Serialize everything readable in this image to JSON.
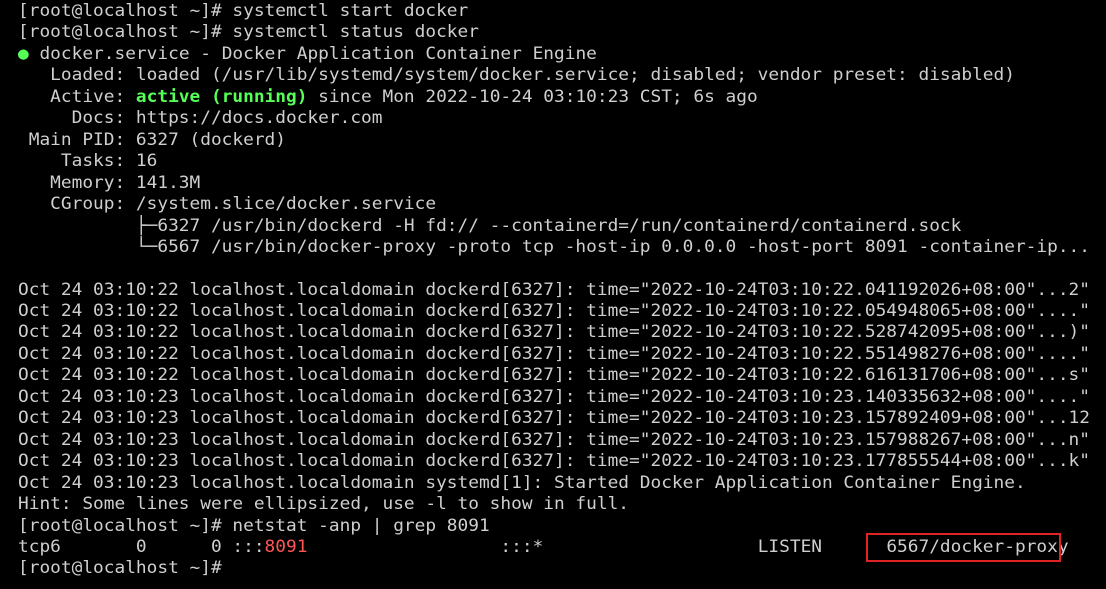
{
  "colors": {
    "background": "#000000",
    "text": "#cfcfcf",
    "active_green": "#55ff55",
    "port_red": "#ff5555",
    "highlight_border": "#e02424"
  },
  "lines": {
    "l01": "[root@localhost ~]# systemctl start docker",
    "l02": "[root@localhost ~]# systemctl status docker",
    "l03_bullet": "●",
    "l03_text": " docker.service - Docker Application Container Engine",
    "l04": "   Loaded: loaded (/usr/lib/systemd/system/docker.service; disabled; vendor preset: disabled)",
    "l05_label": "   Active: ",
    "l05_status": "active (running)",
    "l05_rest": " since Mon 2022-10-24 03:10:23 CST; 6s ago",
    "l06": "     Docs: https://docs.docker.com",
    "l07": " Main PID: 6327 (dockerd)",
    "l08": "    Tasks: 16",
    "l09": "   Memory: 141.3M",
    "l10": "   CGroup: /system.slice/docker.service",
    "l11": "           ├─6327 /usr/bin/dockerd -H fd:// --containerd=/run/containerd/containerd.sock",
    "l12": "           └─6567 /usr/bin/docker-proxy -proto tcp -host-ip 0.0.0.0 -host-port 8091 -container-ip...",
    "l13": "Oct 24 03:10:22 localhost.localdomain dockerd[6327]: time=\"2022-10-24T03:10:22.041192026+08:00\"...2\"",
    "l14": "Oct 24 03:10:22 localhost.localdomain dockerd[6327]: time=\"2022-10-24T03:10:22.054948065+08:00\"....\"",
    "l15": "Oct 24 03:10:22 localhost.localdomain dockerd[6327]: time=\"2022-10-24T03:10:22.528742095+08:00\"...)\"",
    "l16": "Oct 24 03:10:22 localhost.localdomain dockerd[6327]: time=\"2022-10-24T03:10:22.551498276+08:00\"....\"",
    "l17": "Oct 24 03:10:22 localhost.localdomain dockerd[6327]: time=\"2022-10-24T03:10:22.616131706+08:00\"...s\"",
    "l18": "Oct 24 03:10:23 localhost.localdomain dockerd[6327]: time=\"2022-10-24T03:10:23.140335632+08:00\"....\"",
    "l19": "Oct 24 03:10:23 localhost.localdomain dockerd[6327]: time=\"2022-10-24T03:10:23.157892409+08:00\"...12",
    "l20": "Oct 24 03:10:23 localhost.localdomain dockerd[6327]: time=\"2022-10-24T03:10:23.157988267+08:00\"...n\"",
    "l21": "Oct 24 03:10:23 localhost.localdomain dockerd[6327]: time=\"2022-10-24T03:10:23.177855544+08:00\"...k\"",
    "l22": "Oct 24 03:10:23 localhost.localdomain systemd[1]: Started Docker Application Container Engine.",
    "l23": "Hint: Some lines were ellipsized, use -l to show in full.",
    "l24": "[root@localhost ~]# netstat -anp | grep 8091",
    "l25_pre": "tcp6       0      0 :::",
    "l25_port": "8091",
    "l25_mid": "                  :::*                    LISTEN      ",
    "l25_proc": "6567/docker-proxy",
    "l26": "[root@localhost ~]# "
  }
}
